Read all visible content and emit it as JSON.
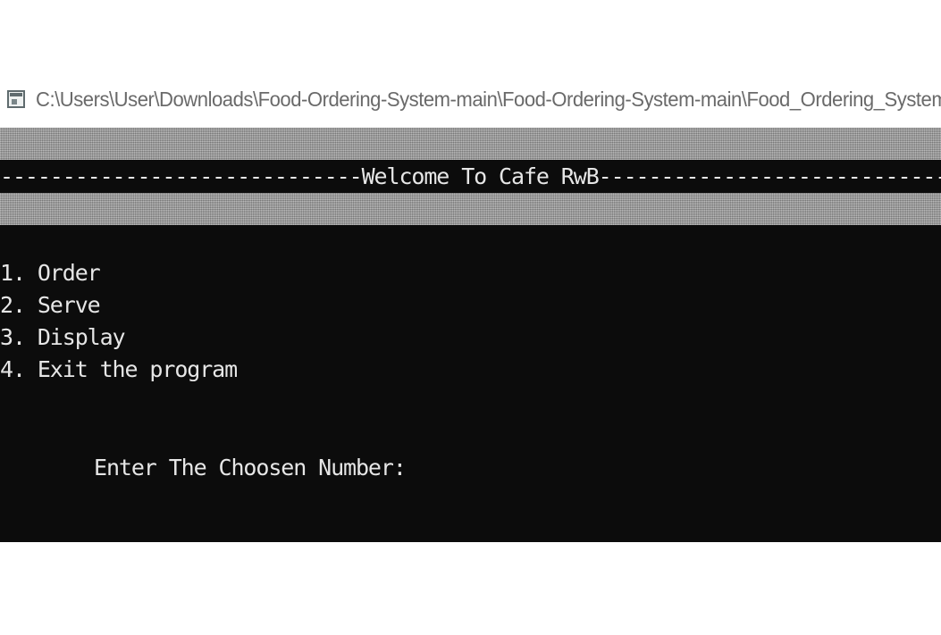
{
  "window": {
    "icon": "console-window-icon",
    "title": "C:\\Users\\User\\Downloads\\Food-Ordering-System-main\\Food-Ordering-System-main\\Food_Ordering_System"
  },
  "console": {
    "background": "#0c0c0c",
    "text_color": "#e6e6e6",
    "banner": "-----------------------------Welcome To Cafe RwB----------------------------------",
    "menu": [
      {
        "label": "1. Order"
      },
      {
        "label": "2. Serve"
      },
      {
        "label": "3. Display"
      },
      {
        "label": "4. Exit the program"
      }
    ],
    "prompt": "Enter The Choosen Number:"
  }
}
